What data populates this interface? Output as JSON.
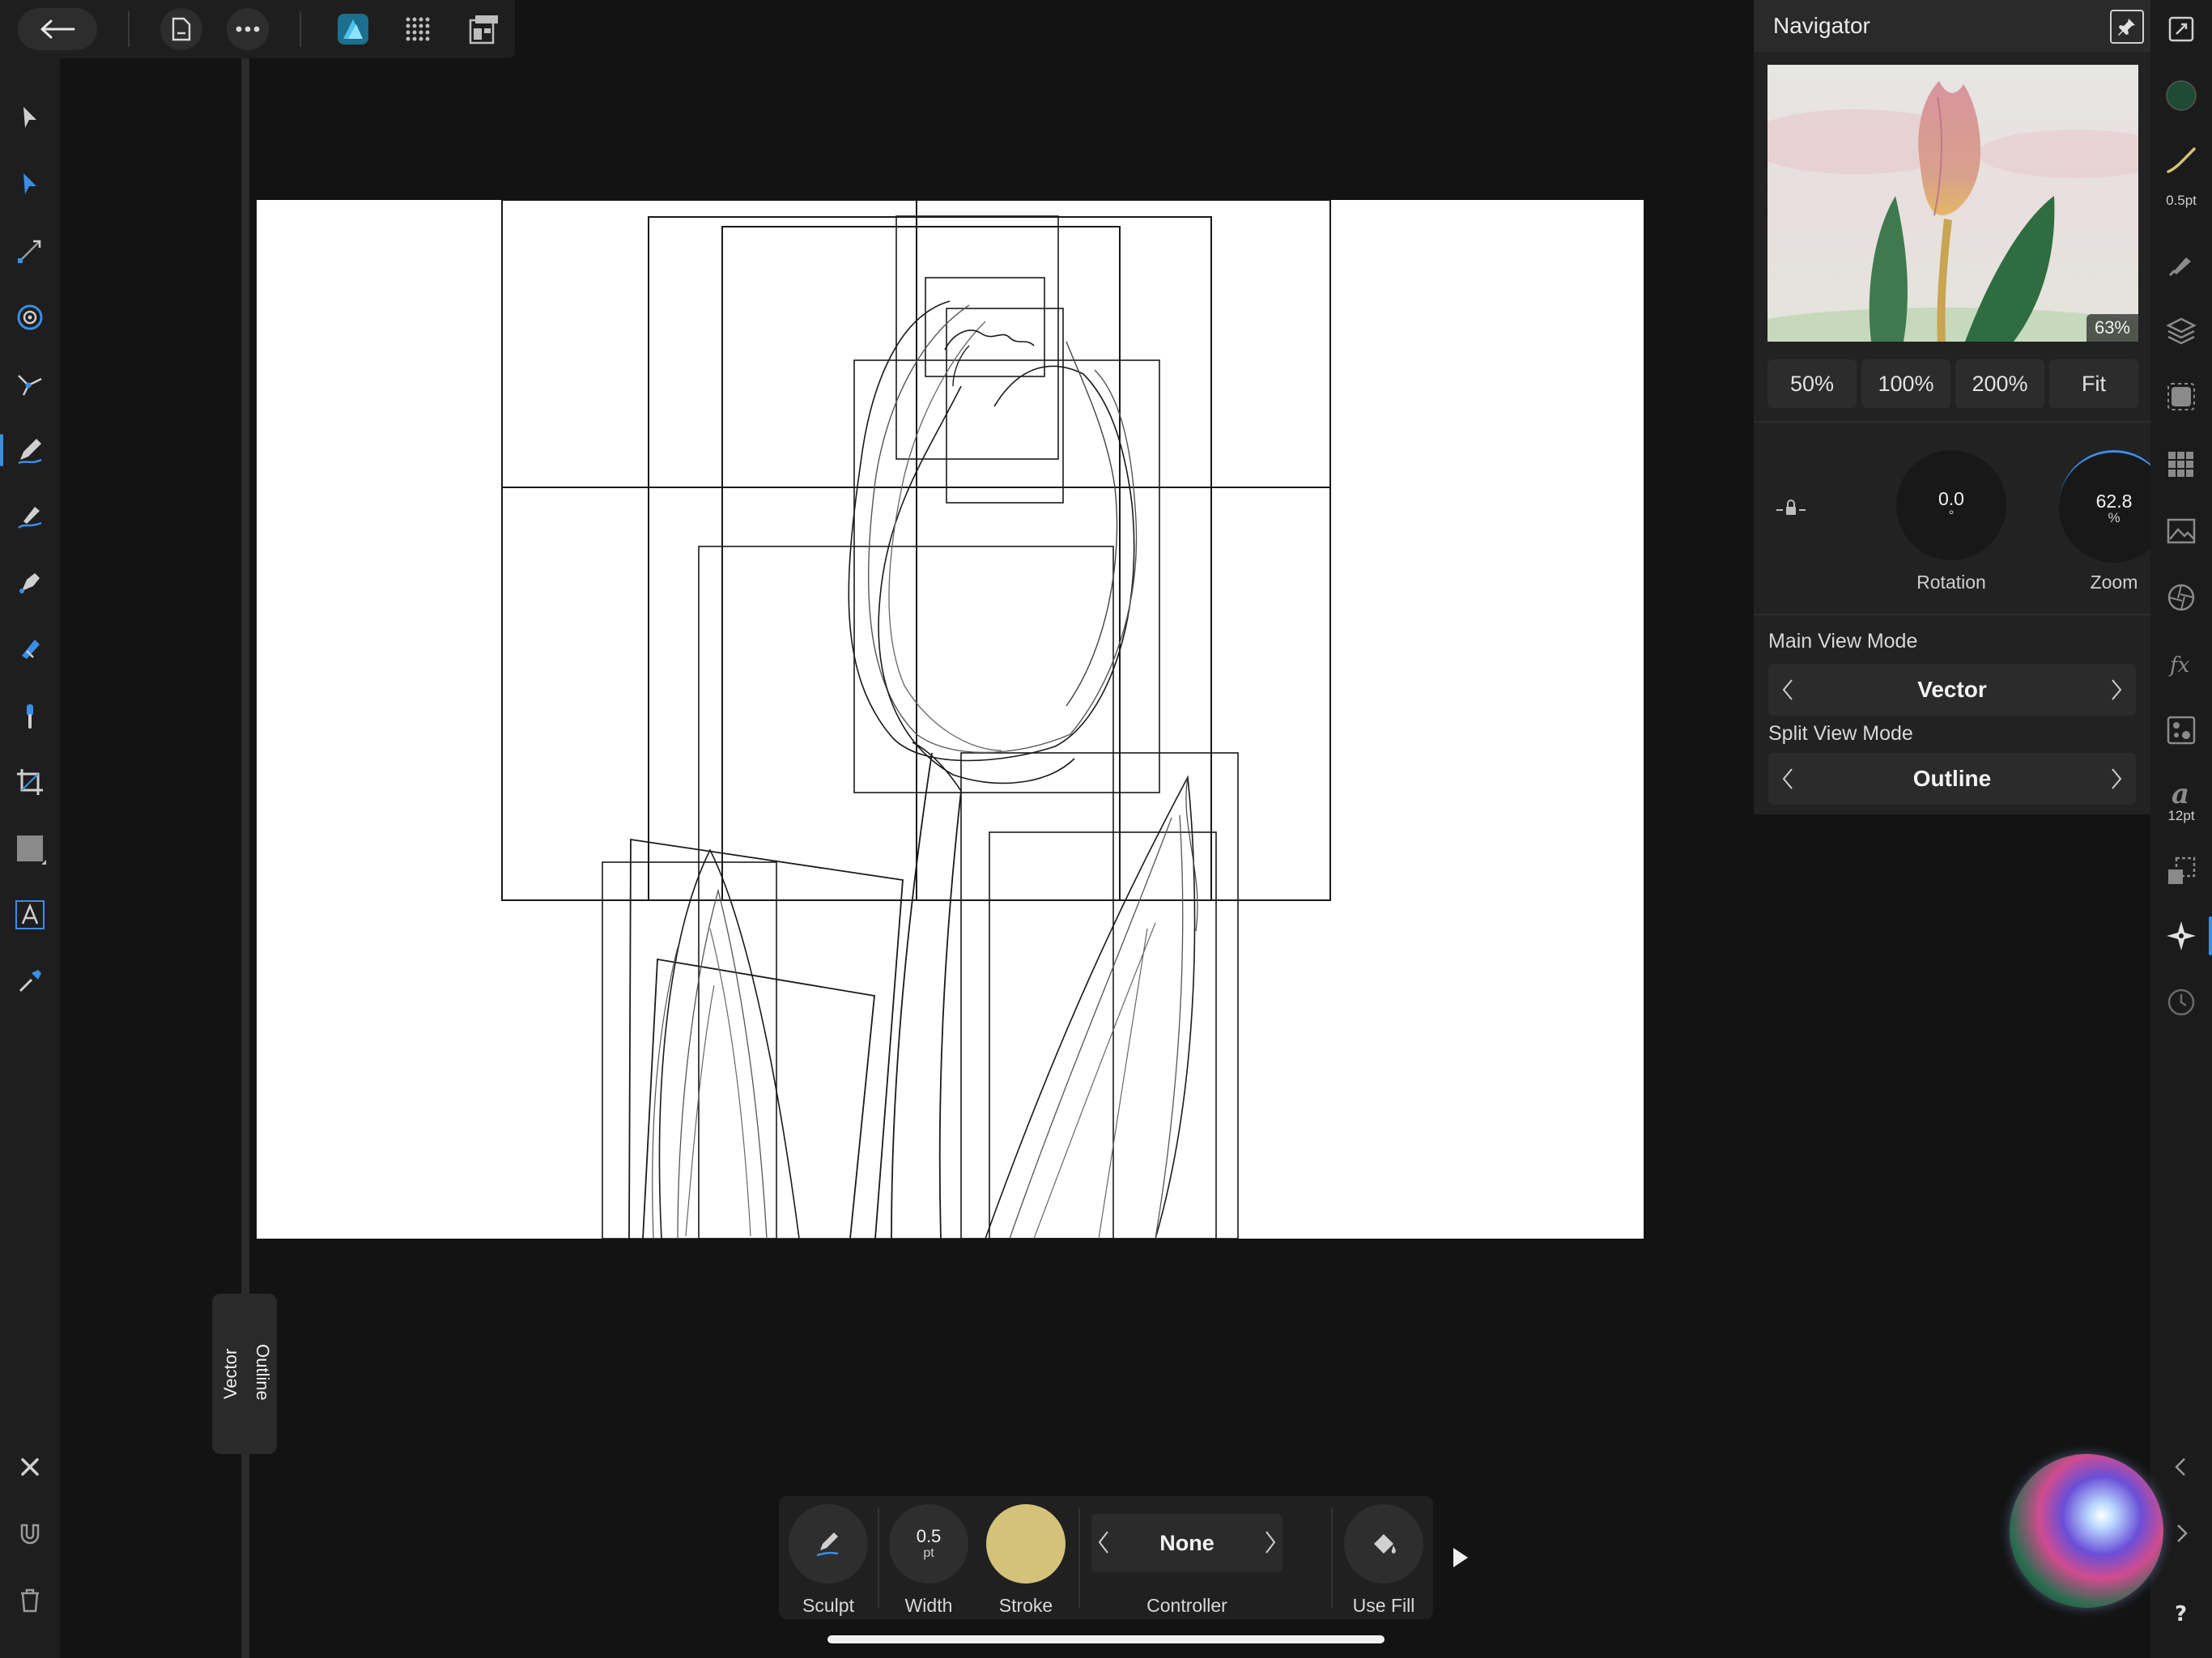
{
  "navigator": {
    "title": "Navigator",
    "preview_zoom": "63%",
    "zoom_presets": [
      "50%",
      "100%",
      "200%",
      "Fit"
    ],
    "rotation": {
      "value": "0.0",
      "unit": "°",
      "label": "Rotation"
    },
    "zoom": {
      "value": "62.8",
      "unit": "%",
      "label": "Zoom"
    },
    "main_view_mode": {
      "label": "Main View Mode",
      "value": "Vector"
    },
    "split_view_mode": {
      "label": "Split View Mode",
      "value": "Outline"
    }
  },
  "split_handle": {
    "left": "Vector",
    "right": "Outline"
  },
  "studio": {
    "stroke_width": "0.5pt",
    "font_size": "12pt",
    "fill_color": "#1f4a34"
  },
  "context_toolbar": {
    "sculpt": "Sculpt",
    "width_value": "0.5",
    "width_unit": "pt",
    "width_label": "Width",
    "stroke_label": "Stroke",
    "stroke_color": "#d4c27a",
    "controller_value": "None",
    "controller_label": "Controller",
    "use_fill_label": "Use Fill"
  },
  "colors": {
    "accent": "#3a8ee6",
    "affinity_blue": "#4fc3e8"
  }
}
